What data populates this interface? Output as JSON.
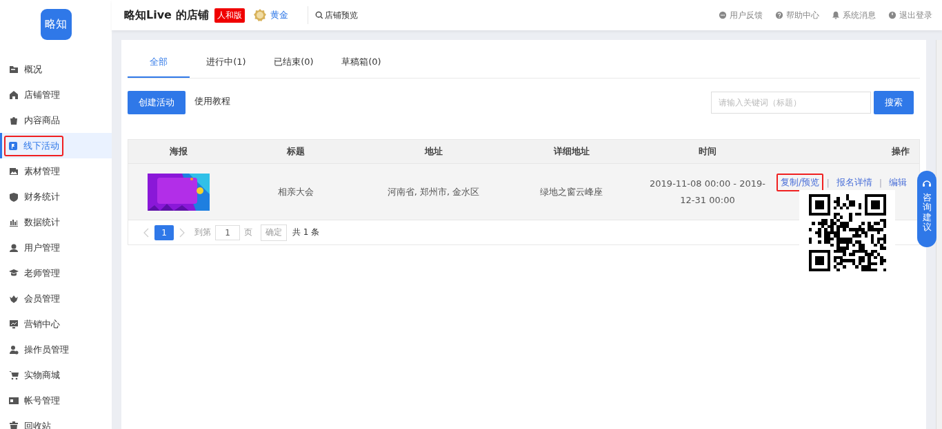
{
  "logo": {
    "text": "略知"
  },
  "sidebar": {
    "items": [
      {
        "label": "概况",
        "selected": false,
        "highlighted": false
      },
      {
        "label": "店铺管理",
        "selected": false,
        "highlighted": false
      },
      {
        "label": "内容商品",
        "selected": false,
        "highlighted": false
      },
      {
        "label": "线下活动",
        "selected": true,
        "highlighted": true
      },
      {
        "label": "素材管理",
        "selected": false,
        "highlighted": false
      },
      {
        "label": "财务统计",
        "selected": false,
        "highlighted": false
      },
      {
        "label": "数据统计",
        "selected": false,
        "highlighted": false
      },
      {
        "label": "用户管理",
        "selected": false,
        "highlighted": false
      },
      {
        "label": "老师管理",
        "selected": false,
        "highlighted": false
      },
      {
        "label": "会员管理",
        "selected": false,
        "highlighted": false
      },
      {
        "label": "营销中心",
        "selected": false,
        "highlighted": false
      },
      {
        "label": "操作员管理",
        "selected": false,
        "highlighted": false
      },
      {
        "label": "实物商城",
        "selected": false,
        "highlighted": false
      },
      {
        "label": "帐号管理",
        "selected": false,
        "highlighted": false
      },
      {
        "label": "回收站",
        "selected": false,
        "highlighted": false
      }
    ]
  },
  "header": {
    "title": "略知Live 的店铺",
    "edition_badge": "人和版",
    "level": "黄金",
    "preview_link": "店铺预览",
    "links": [
      {
        "label": "用户反馈"
      },
      {
        "label": "帮助中心"
      },
      {
        "label": "系统消息"
      },
      {
        "label": "退出登录"
      }
    ]
  },
  "tabs": [
    {
      "label": "全部",
      "selected": true
    },
    {
      "label": "进行中(1)",
      "selected": false
    },
    {
      "label": "已结束(0)",
      "selected": false
    },
    {
      "label": "草稿箱(0)",
      "selected": false
    }
  ],
  "toolbar": {
    "create_button": "创建活动",
    "tutorial_link": "使用教程",
    "search": {
      "placeholder": "请输入关键词（标题）"
    },
    "search_button": "搜索"
  },
  "table": {
    "columns": [
      "海报",
      "标题",
      "地址",
      "详细地址",
      "时间",
      "操作"
    ],
    "rows": [
      {
        "poster": {
          "kind": "picture"
        },
        "title": "相亲大会",
        "address": "河南省, 郑州市, 金水区",
        "detail_address": "绿地之窗云峰座",
        "time": "2019-11-08 00:00 - 2019-12-31 00:00",
        "actions": [
          {
            "label": "复制/预览",
            "highlighted": true
          },
          {
            "separator": "|"
          },
          {
            "label": "报名详情",
            "highlighted": false
          },
          {
            "separator": "|"
          },
          {
            "label": "编辑",
            "highlighted": false
          }
        ]
      }
    ]
  },
  "pagination": {
    "pages": [
      {
        "label": "1",
        "selected": true
      }
    ],
    "goto_label": "到第",
    "goto_value": "1",
    "page_unit": "页",
    "confirm_button": "确定",
    "total": "共 1 条"
  },
  "qr_popup": {
    "open": true
  },
  "float_button": {
    "label": "咨询建议"
  }
}
